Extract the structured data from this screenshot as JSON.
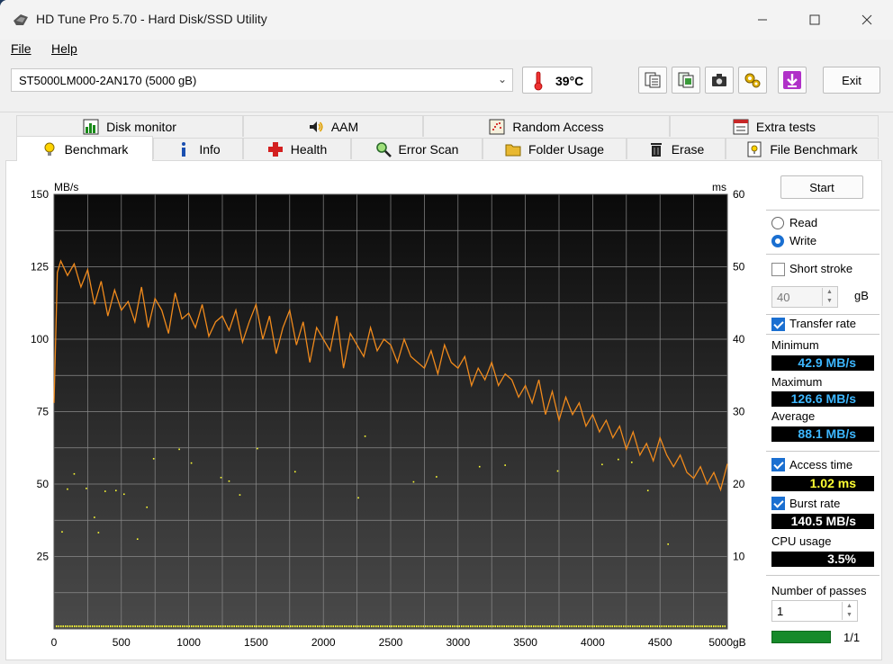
{
  "window": {
    "title": "HD Tune Pro 5.70 - Hard Disk/SSD Utility"
  },
  "menu": {
    "file": "File",
    "help": "Help"
  },
  "toolbar": {
    "drive": "ST5000LM000-2AN170 (5000 gB)",
    "temperature": "39°C",
    "exit_label": "Exit"
  },
  "tabs_top": [
    "Disk monitor",
    "AAM",
    "Random Access",
    "Extra tests"
  ],
  "tabs_bottom": [
    "Benchmark",
    "Info",
    "Health",
    "Error Scan",
    "Folder Usage",
    "Erase",
    "File Benchmark"
  ],
  "right_panel": {
    "start_label": "Start",
    "read_label": "Read",
    "write_label": "Write",
    "mode_selected": "Write",
    "short_stroke_label": "Short stroke",
    "short_stroke_checked": false,
    "stroke_value": "40",
    "stroke_unit": "gB",
    "transfer_rate_label": "Transfer rate",
    "transfer_rate_checked": true,
    "minimum_label": "Minimum",
    "minimum_value": "42.9 MB/s",
    "maximum_label": "Maximum",
    "maximum_value": "126.6 MB/s",
    "average_label": "Average",
    "average_value": "88.1 MB/s",
    "access_time_label": "Access time",
    "access_time_checked": true,
    "access_time_value": "1.02 ms",
    "burst_rate_label": "Burst rate",
    "burst_rate_checked": true,
    "burst_rate_value": "140.5 MB/s",
    "cpu_usage_label": "CPU usage",
    "cpu_usage_value": "3.5%",
    "passes_label": "Number of passes",
    "passes_value": "1",
    "progress_text": "1/1",
    "progress_fraction": 1.0
  },
  "chart_data": {
    "type": "line",
    "ylabel_left": "MB/s",
    "ylabel_right": "ms",
    "x_unit": "gB",
    "xlim": [
      0,
      5000
    ],
    "ylim_left": [
      0,
      150
    ],
    "ylim_right": [
      0,
      60
    ],
    "x_ticks": [
      "0",
      "500",
      "1000",
      "1500",
      "2000",
      "2500",
      "3000",
      "3500",
      "4000",
      "4500",
      "5000gB"
    ],
    "y_ticks_left": [
      "150",
      "125",
      "100",
      "75",
      "50",
      "25"
    ],
    "y_ticks_right": [
      "60",
      "50",
      "40",
      "30",
      "20",
      "10"
    ],
    "grid": true,
    "series": [
      {
        "name": "Transfer rate",
        "color": "#f08a1c",
        "x": [
          0,
          25,
          50,
          100,
          150,
          200,
          250,
          300,
          350,
          400,
          450,
          500,
          550,
          600,
          650,
          700,
          750,
          800,
          850,
          900,
          950,
          1000,
          1050,
          1100,
          1150,
          1200,
          1250,
          1300,
          1350,
          1400,
          1450,
          1500,
          1550,
          1600,
          1650,
          1700,
          1750,
          1800,
          1850,
          1900,
          1950,
          2000,
          2050,
          2100,
          2150,
          2200,
          2250,
          2300,
          2350,
          2400,
          2450,
          2500,
          2550,
          2600,
          2650,
          2700,
          2750,
          2800,
          2850,
          2900,
          2950,
          3000,
          3050,
          3100,
          3150,
          3200,
          3250,
          3300,
          3350,
          3400,
          3450,
          3500,
          3550,
          3600,
          3650,
          3700,
          3750,
          3800,
          3850,
          3900,
          3950,
          4000,
          4050,
          4100,
          4150,
          4200,
          4250,
          4300,
          4350,
          4400,
          4450,
          4500,
          4550,
          4600,
          4650,
          4700,
          4750,
          4800,
          4850,
          4900,
          4950,
          5000
        ],
        "values": [
          78,
          123,
          127,
          122,
          126,
          118,
          124,
          112,
          120,
          108,
          117,
          110,
          113,
          106,
          118,
          104,
          114,
          110,
          102,
          116,
          107,
          109,
          104,
          112,
          101,
          106,
          108,
          103,
          110,
          99,
          106,
          112,
          100,
          108,
          95,
          104,
          110,
          98,
          106,
          92,
          104,
          100,
          96,
          108,
          90,
          102,
          98,
          94,
          104,
          96,
          100,
          98,
          92,
          100,
          94,
          92,
          90,
          96,
          88,
          98,
          92,
          90,
          94,
          84,
          90,
          86,
          92,
          84,
          88,
          86,
          80,
          84,
          78,
          86,
          74,
          82,
          72,
          80,
          74,
          78,
          70,
          74,
          68,
          72,
          66,
          70,
          62,
          68,
          60,
          64,
          58,
          66,
          60,
          56,
          60,
          54,
          52,
          56,
          50,
          54,
          48,
          57
        ],
        "axis": "left"
      },
      {
        "name": "Access time",
        "color": "#ffff33",
        "type": "scatter",
        "x": [
          60,
          100,
          150,
          240,
          300,
          330,
          380,
          460,
          520,
          620,
          690,
          740,
          930,
          1020,
          1240,
          1300,
          1380,
          1510,
          1790,
          2260,
          2310,
          2670,
          2840,
          3160,
          3350,
          3740,
          4070,
          4190,
          4290,
          4410,
          4560
        ],
        "values": [
          13.4,
          19.3,
          21.4,
          19.4,
          15.4,
          13.3,
          19.0,
          19.1,
          18.6,
          12.4,
          16.8,
          23.5,
          24.8,
          22.9,
          20.9,
          20.4,
          18.5,
          24.9,
          21.7,
          18.1,
          26.6,
          20.3,
          21.0,
          22.4,
          22.6,
          21.8,
          22.7,
          23.4,
          23.0,
          19.1,
          11.7
        ],
        "axis": "right"
      }
    ]
  }
}
